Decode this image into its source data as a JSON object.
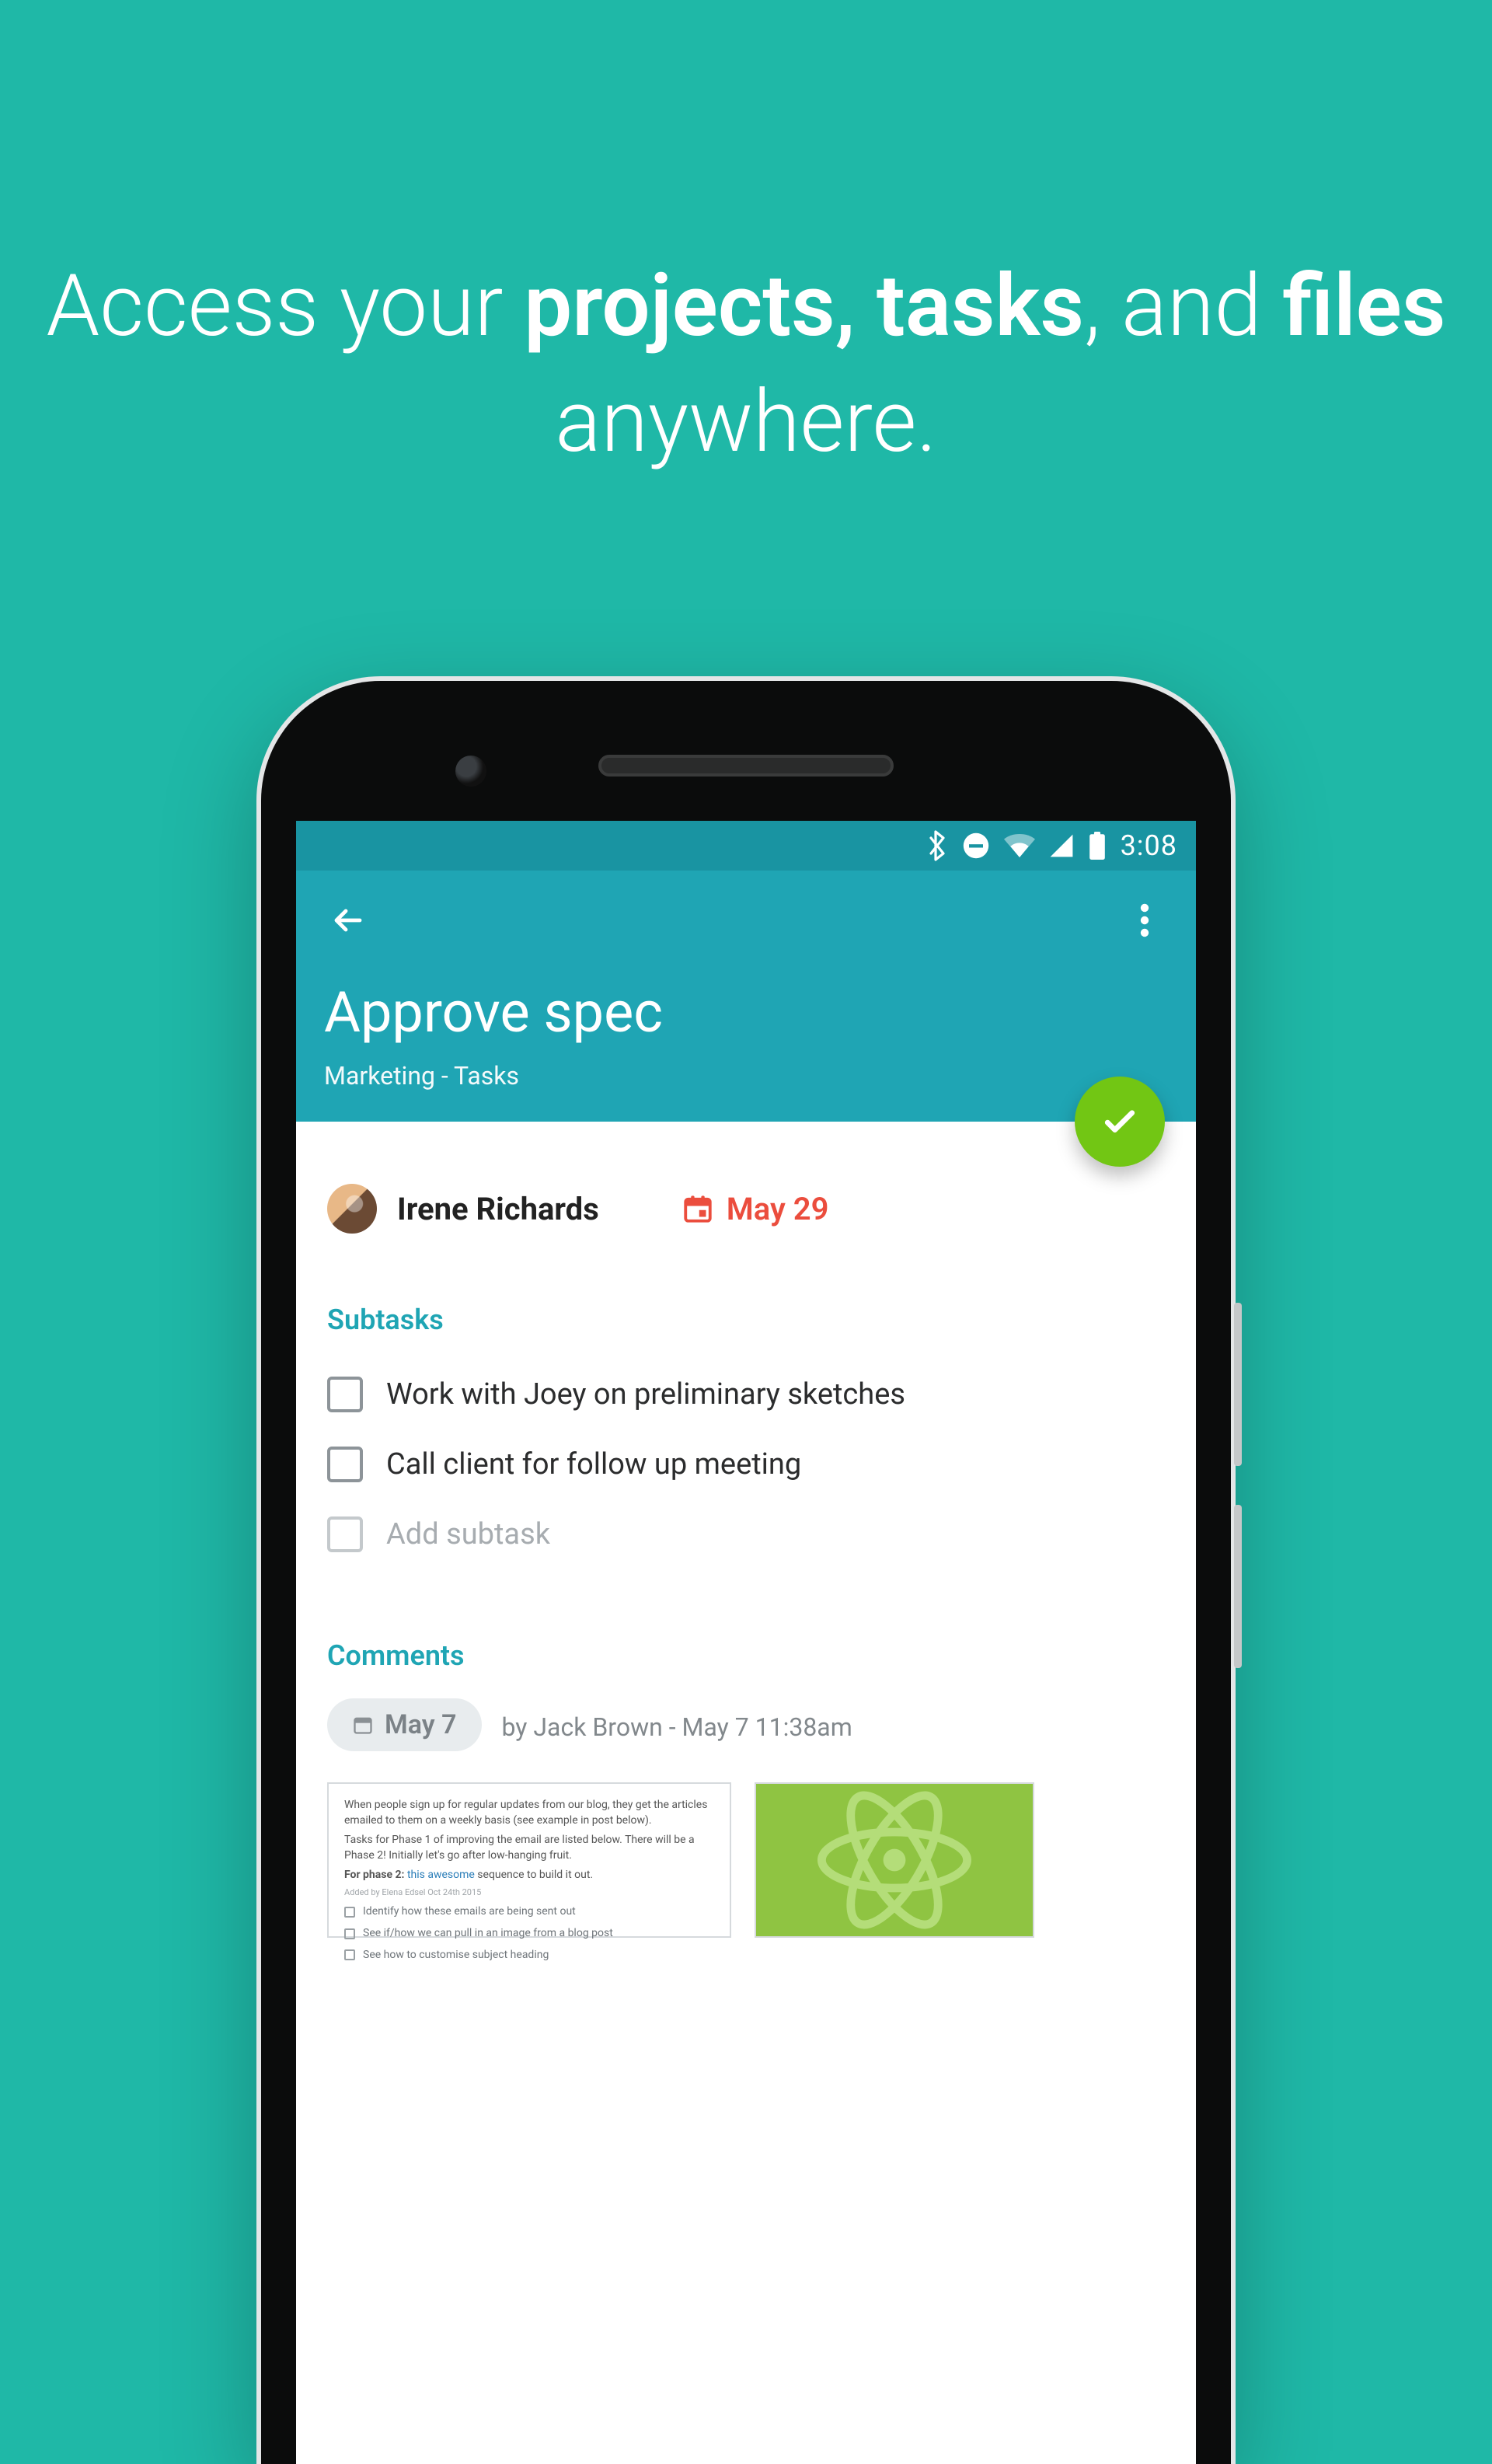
{
  "headline": {
    "p1": "Access your ",
    "b1": "projects, tasks",
    "p2": ", and ",
    "b2": "files",
    "p3": " anywhere."
  },
  "statusbar": {
    "time": "3:08"
  },
  "appbar": {
    "title": "Approve spec",
    "subtitle": "Marketing - Tasks"
  },
  "task": {
    "assignee": "Irene Richards",
    "due": "May 29"
  },
  "sections": {
    "subtasks_title": "Subtasks",
    "comments_title": "Comments"
  },
  "subtasks": [
    {
      "label": "Work with Joey on preliminary sketches"
    },
    {
      "label": "Call client for follow up meeting"
    }
  ],
  "add_subtask_placeholder": "Add subtask",
  "comment": {
    "chip_date": "May 7",
    "meta": "by Jack Brown - May 7 11:38am"
  },
  "colors": {
    "bg": "#1fb8a7",
    "appbar": "#1fa5b4",
    "status": "#1994a2",
    "fab": "#72c614",
    "due": "#eb4d3d"
  }
}
